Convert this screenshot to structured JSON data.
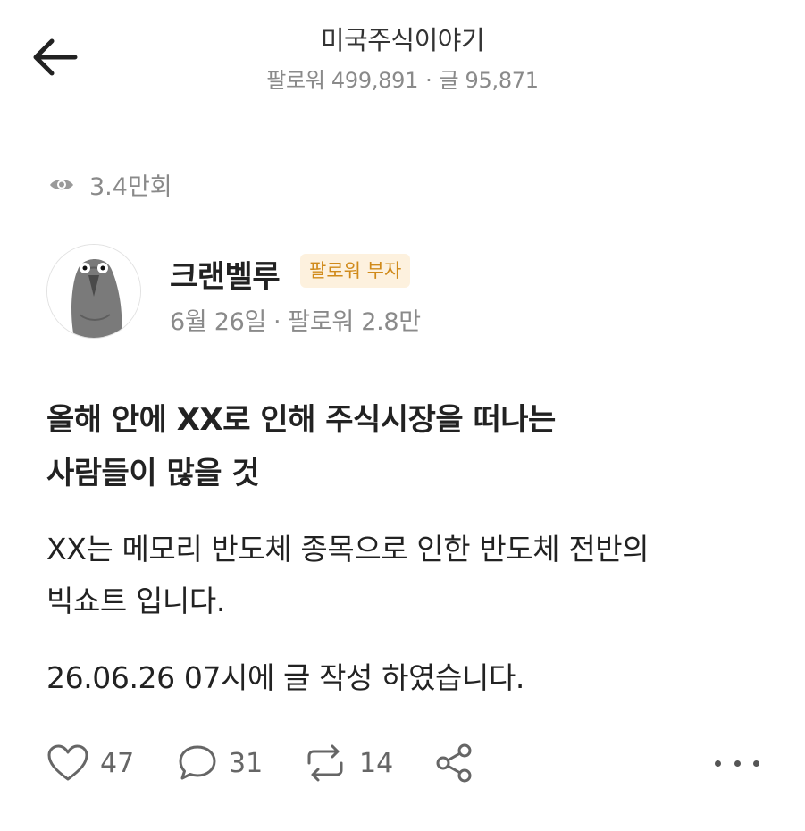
{
  "header": {
    "title": "미국주식이야기",
    "followers_label": "팔로워 499,891",
    "posts_label": "글 95,871",
    "separator": "·"
  },
  "views": {
    "count": "3.4만회",
    "icon": "eye-icon"
  },
  "author": {
    "name": "크랜벨루",
    "badge": "팔로워 부자",
    "date": "6월 26일",
    "followers": "팔로워 2.8만",
    "separator": "·",
    "avatar_icon": "pigeon-avatar"
  },
  "post": {
    "title_line1": "올해 안에 XX로 인해 주식시장을 떠나는",
    "title_line2": "사람들이 많을 것",
    "body_line1": "XX는 메모리 반도체 종목으로 인한 반도체 전반의",
    "body_line2": "빅쇼트 입니다.",
    "body_line3": "26.06.26 07시에 글 작성 하였습니다."
  },
  "actions": {
    "likes": "47",
    "comments": "31",
    "reposts": "14",
    "icons": [
      "heart-icon",
      "comment-icon",
      "repost-icon",
      "share-icon",
      "more-icon"
    ]
  },
  "colors": {
    "badge_bg": "#fdf1de",
    "badge_text": "#d08a1a",
    "muted_text": "#8a8a8a",
    "primary_text": "#222222"
  }
}
